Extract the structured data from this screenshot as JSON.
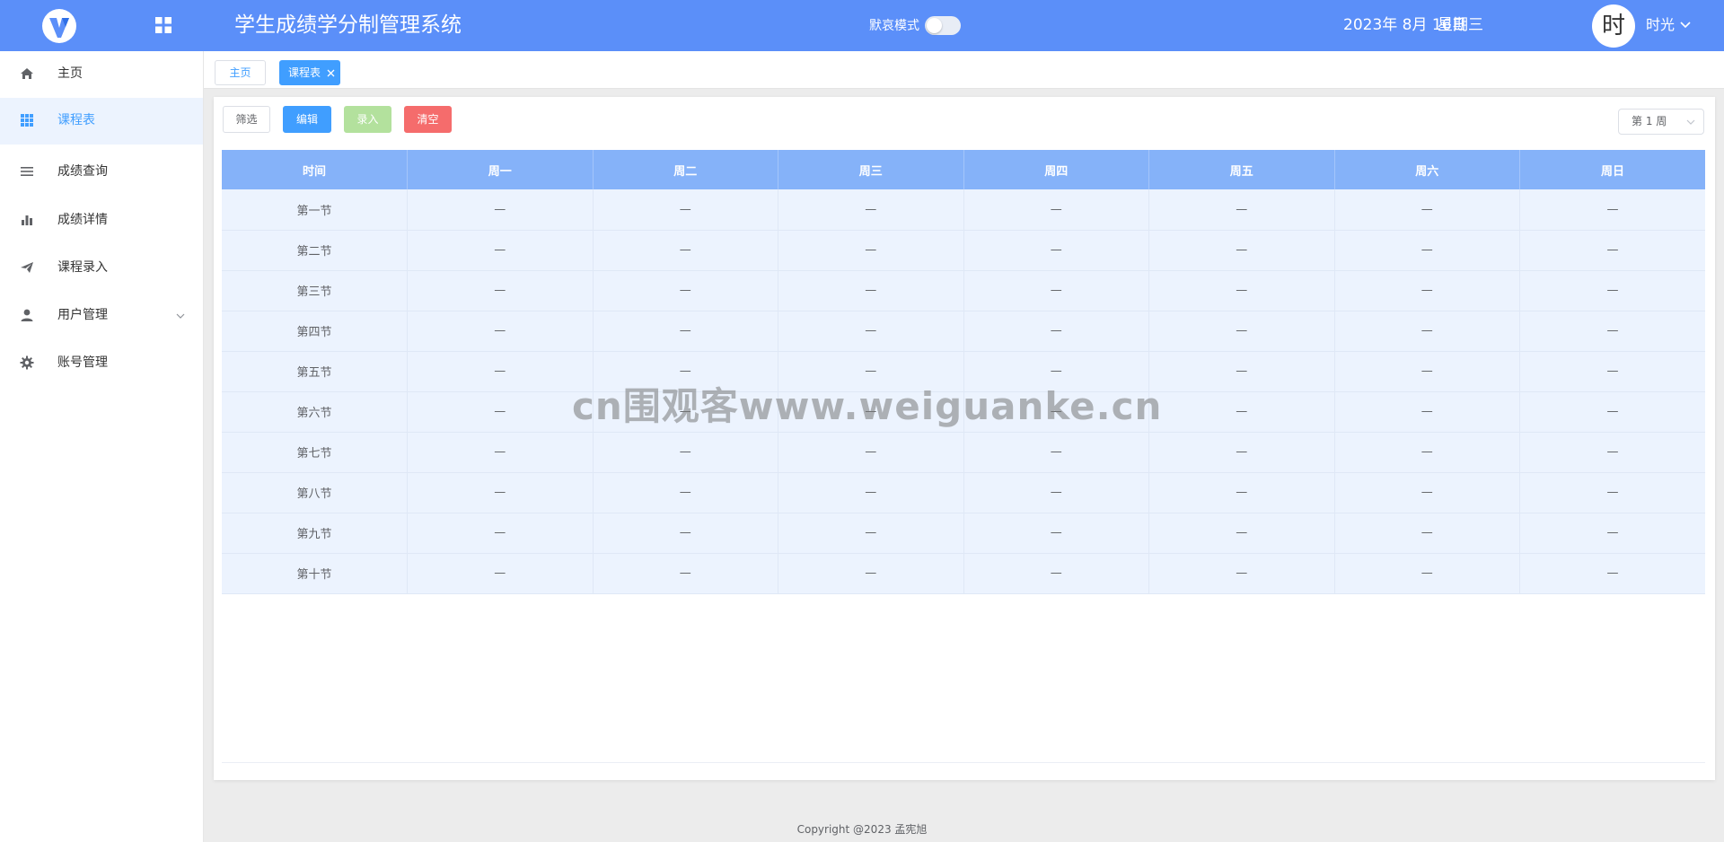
{
  "header": {
    "title": "学生成绩学分制管理系统",
    "theme_label": "默哀模式",
    "date": "2023年 8月 16日",
    "weekday": "星期三",
    "avatar_text": "时",
    "user_name": "时光",
    "color": "#5b8ff9"
  },
  "sidebar": {
    "items": [
      {
        "label": "主页",
        "icon": "home-icon"
      },
      {
        "label": "课程表",
        "icon": "grid-icon",
        "active": true
      },
      {
        "label": "成绩查询",
        "icon": "list-icon"
      },
      {
        "label": "成绩详情",
        "icon": "bar-chart-icon"
      },
      {
        "label": "课程录入",
        "icon": "paper-plane-icon"
      },
      {
        "label": "用户管理",
        "icon": "user-icon",
        "has_submenu": true
      },
      {
        "label": "账号管理",
        "icon": "gear-icon"
      }
    ]
  },
  "tabs": [
    {
      "label": "主页"
    },
    {
      "label": "课程表",
      "active": true
    }
  ],
  "toolbar": {
    "filter_label": "筛选",
    "edit_label": "编辑",
    "input_label": "录入",
    "clear_label": "清空",
    "week_select_value": "第 1 周"
  },
  "table": {
    "columns": [
      "时间",
      "周一",
      "周二",
      "周三",
      "周四",
      "周五",
      "周六",
      "周日"
    ],
    "rows": [
      [
        "第一节",
        "—",
        "—",
        "—",
        "—",
        "—",
        "—",
        "—"
      ],
      [
        "第二节",
        "—",
        "—",
        "—",
        "—",
        "—",
        "—",
        "—"
      ],
      [
        "第三节",
        "—",
        "—",
        "—",
        "—",
        "—",
        "—",
        "—"
      ],
      [
        "第四节",
        "—",
        "—",
        "—",
        "—",
        "—",
        "—",
        "—"
      ],
      [
        "第五节",
        "—",
        "—",
        "—",
        "—",
        "—",
        "—",
        "—"
      ],
      [
        "第六节",
        "—",
        "—",
        "—",
        "—",
        "—",
        "—",
        "—"
      ],
      [
        "第七节",
        "—",
        "—",
        "—",
        "—",
        "—",
        "—",
        "—"
      ],
      [
        "第八节",
        "—",
        "—",
        "—",
        "—",
        "—",
        "—",
        "—"
      ],
      [
        "第九节",
        "—",
        "—",
        "—",
        "—",
        "—",
        "—",
        "—"
      ],
      [
        "第十节",
        "—",
        "—",
        "—",
        "—",
        "—",
        "—",
        "—"
      ]
    ]
  },
  "watermark": "cn围观客www.weiguanke.cn",
  "footer": "Copyright @2023 孟宪旭"
}
